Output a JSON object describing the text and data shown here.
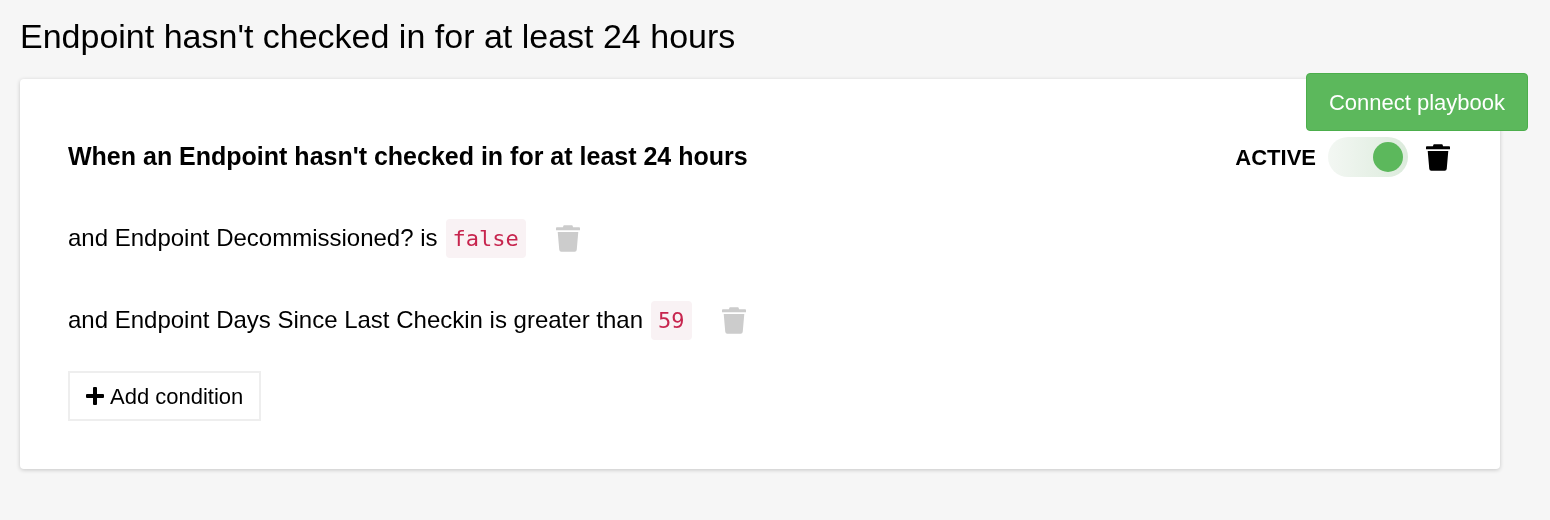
{
  "page_title": "Endpoint hasn't checked in for at least 24 hours",
  "connect_button": "Connect playbook",
  "rule": {
    "title": "When an Endpoint hasn't checked in for at least 24 hours",
    "status_label": "ACTIVE",
    "active": true,
    "conditions": [
      {
        "text": "and Endpoint Decommissioned? is",
        "value": "false"
      },
      {
        "text": "and Endpoint Days Since Last Checkin is greater than",
        "value": "59"
      }
    ],
    "add_button": "Add condition"
  }
}
